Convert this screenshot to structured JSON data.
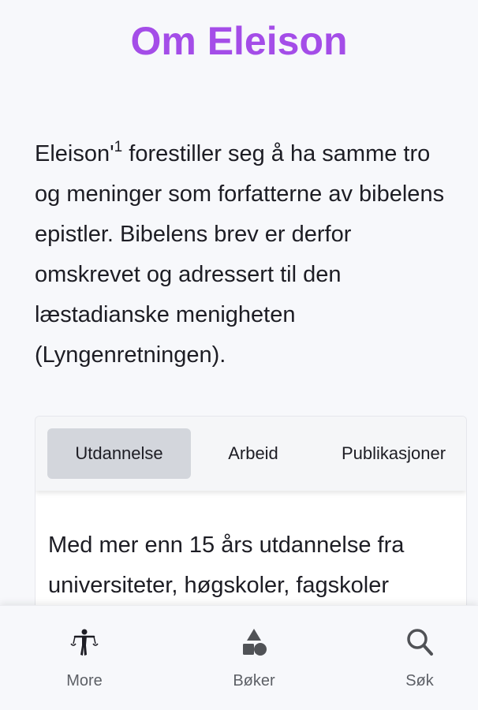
{
  "header": {
    "title": "Om Eleison"
  },
  "intro": {
    "name": "Eleison'",
    "footnote": "1",
    "text": " forestiller seg å ha samme tro og meninger som forfatterne av bibelens epistler. Bibelens brev er derfor omskrevet og adressert til den læstadianske menigheten (Lyngenretningen)."
  },
  "tabs": {
    "items": [
      {
        "label": "Utdannelse",
        "active": true
      },
      {
        "label": "Arbeid",
        "active": false
      },
      {
        "label": "Publikasjoner",
        "active": false
      }
    ]
  },
  "tab_content": {
    "text": "Med mer enn 15 års utdannelse fra universiteter, høgskoler, fagskoler"
  },
  "bottom_nav": {
    "items": [
      {
        "label": "More",
        "icon": "figure-icon"
      },
      {
        "label": "Bøker",
        "icon": "shapes-icon"
      },
      {
        "label": "Søk",
        "icon": "search-icon"
      }
    ]
  },
  "colors": {
    "title": "#a44de8",
    "active_tab": "#d3d6dc",
    "background": "#f7f8fb",
    "nav_label": "#5d6066"
  }
}
